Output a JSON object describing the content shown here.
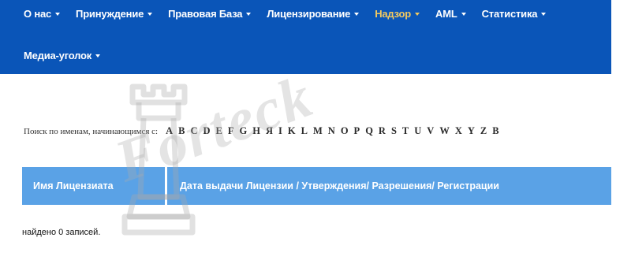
{
  "nav": {
    "row1": [
      {
        "label": "О нас",
        "active": false
      },
      {
        "label": "Принуждение",
        "active": false
      },
      {
        "label": "Правовая База",
        "active": false
      },
      {
        "label": "Лицензирование",
        "active": false
      },
      {
        "label": "Надзор",
        "active": true
      },
      {
        "label": "AML",
        "active": false
      },
      {
        "label": "Статистика",
        "active": false
      }
    ],
    "row2": [
      {
        "label": "Медиа-уголок",
        "active": false
      }
    ],
    "colors": {
      "background": "#0a55b8",
      "active": "#f3c95f",
      "text": "#ffffff"
    }
  },
  "alpha_search": {
    "label": "Поиск по именам, начинающимся с:",
    "letters": [
      "A",
      "B",
      "C",
      "D",
      "E",
      "F",
      "G",
      "H",
      "Я",
      "I",
      "K",
      "L",
      "M",
      "N",
      "O",
      "P",
      "Q",
      "R",
      "S",
      "T",
      "U",
      "V",
      "W",
      "X",
      "Y",
      "Z",
      "B"
    ]
  },
  "table": {
    "header_color": "#5aa2e6",
    "columns": [
      "Имя Лицензиата",
      "Дата выдачи Лицензии / Утверждения/ Разрешения/ Регистрации"
    ]
  },
  "records_info": "найдено 0 записей.",
  "watermark": {
    "text": "Forteck",
    "icon": "chess-rook-icon"
  }
}
